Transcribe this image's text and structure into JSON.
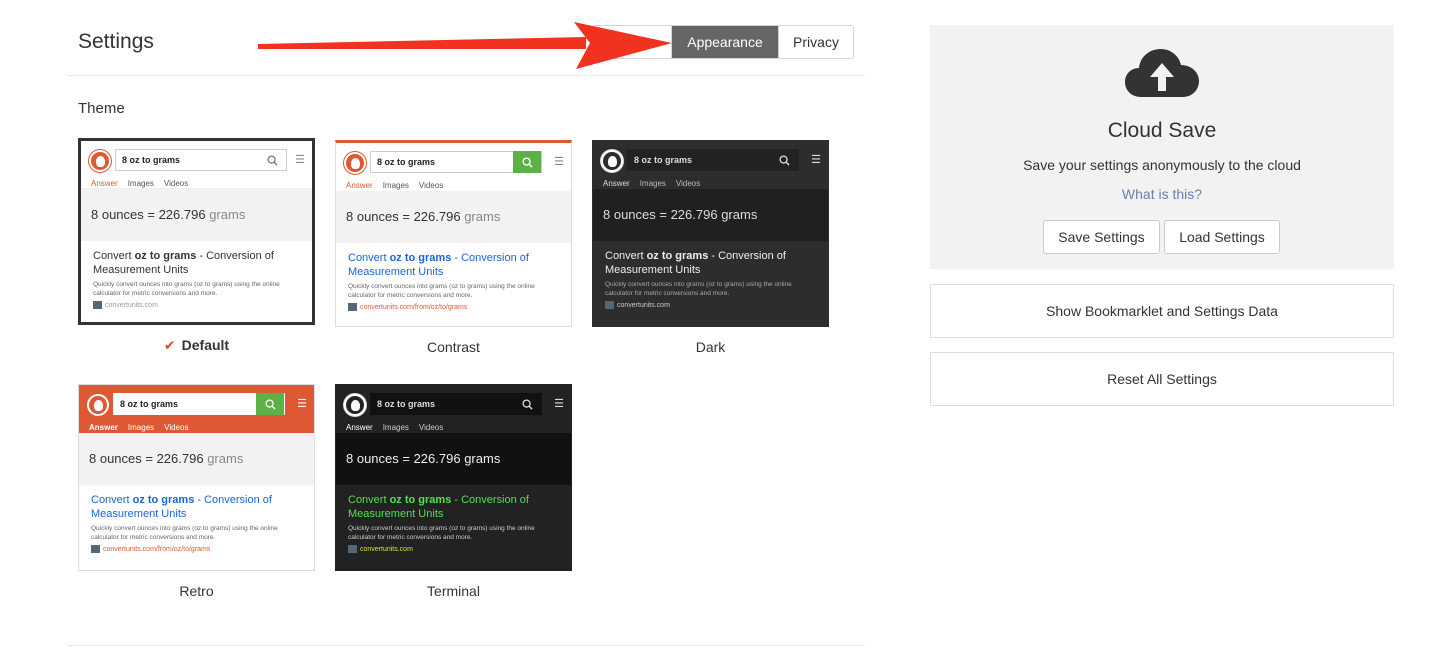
{
  "header": {
    "title": "Settings",
    "tabs": [
      {
        "label": "Appearance",
        "active": true
      },
      {
        "label": "Privacy",
        "active": false
      }
    ]
  },
  "theme_section": {
    "label": "Theme",
    "selected": "Default",
    "themes": [
      {
        "name": "Default"
      },
      {
        "name": "Contrast"
      },
      {
        "name": "Dark"
      },
      {
        "name": "Retro"
      },
      {
        "name": "Terminal"
      }
    ]
  },
  "preview": {
    "query": "8 oz to grams",
    "tabs": [
      "Answer",
      "Images",
      "Videos"
    ],
    "answer_value": "8 ounces = 226.796",
    "answer_unit": "grams",
    "result_title_a": "Convert ",
    "result_title_b": "oz to grams",
    "result_title_c": " - Conversion of Measurement Units",
    "result_snippet": "Quickly convert ounces into grams (oz to grams) using the online calculator for metric conversions and more.",
    "result_url_short": "convertunits.com",
    "result_url_long": "convertunits.com/from/oz/to/grams"
  },
  "cloud_save": {
    "title": "Cloud Save",
    "description": "Save your settings anonymously to the cloud",
    "help_link": "What is this?",
    "save_button": "Save Settings",
    "load_button": "Load Settings"
  },
  "actions": {
    "bookmarklet_button": "Show Bookmarklet and Settings Data",
    "reset_button": "Reset All Settings"
  },
  "colors": {
    "accent": "#de5833",
    "active_tab": "#666666",
    "annotation_arrow": "#f0321e",
    "link": "#6e7eb0"
  }
}
